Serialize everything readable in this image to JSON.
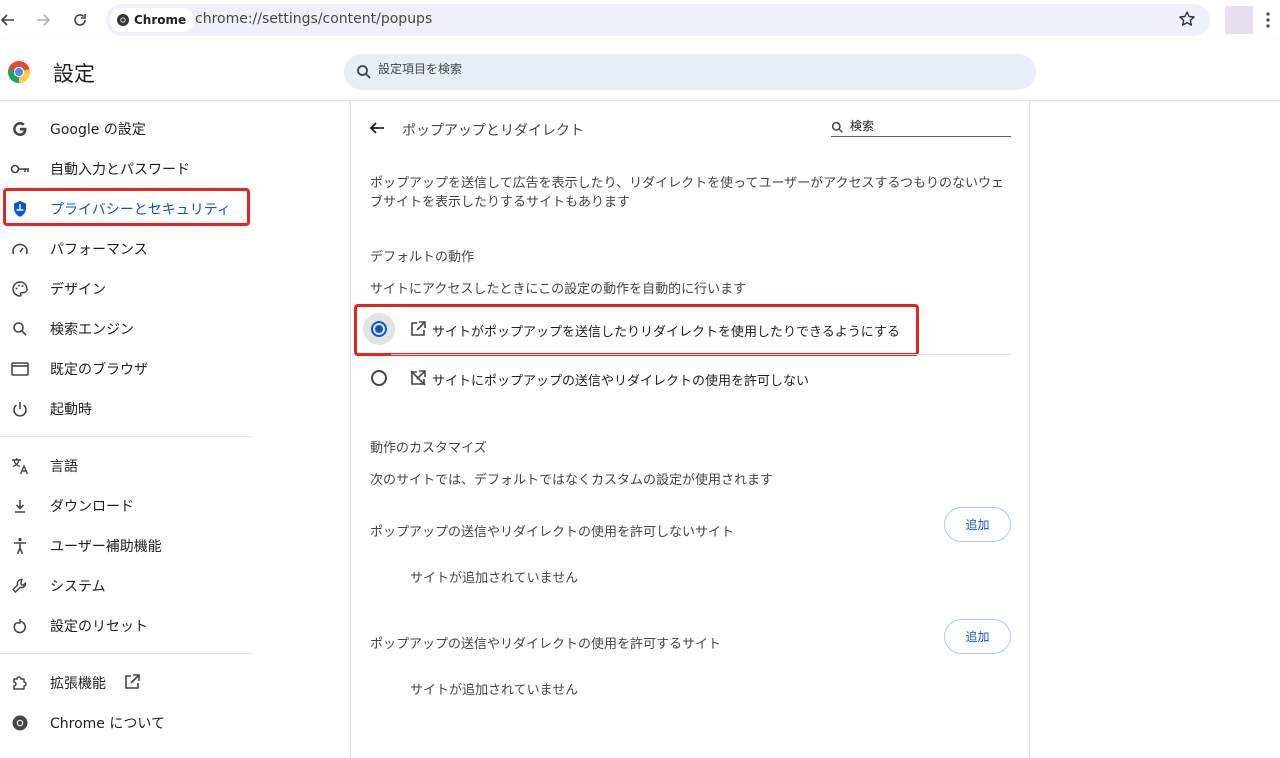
{
  "browser": {
    "chip_label": "Chrome",
    "url": "chrome://settings/content/popups"
  },
  "header": {
    "title": "設定",
    "search_placeholder": "設定項目を検索"
  },
  "sidebar": {
    "items": [
      {
        "label": "Google の設定",
        "icon": "google-g-icon"
      },
      {
        "label": "自動入力とパスワード",
        "icon": "key-icon"
      },
      {
        "label": "プライバシーとセキュリティ",
        "icon": "shield-icon"
      },
      {
        "label": "パフォーマンス",
        "icon": "speedometer-icon"
      },
      {
        "label": "デザイン",
        "icon": "palette-icon"
      },
      {
        "label": "検索エンジン",
        "icon": "search-icon"
      },
      {
        "label": "既定のブラウザ",
        "icon": "browser-window-icon"
      },
      {
        "label": "起動時",
        "icon": "power-icon"
      },
      {
        "label": "言語",
        "icon": "translate-icon"
      },
      {
        "label": "ダウンロード",
        "icon": "download-icon"
      },
      {
        "label": "ユーザー補助機能",
        "icon": "accessibility-icon"
      },
      {
        "label": "システム",
        "icon": "wrench-icon"
      },
      {
        "label": "設定のリセット",
        "icon": "reset-icon"
      },
      {
        "label": "拡張機能",
        "icon": "puzzle-icon"
      },
      {
        "label": "Chrome について",
        "icon": "chrome-icon"
      }
    ]
  },
  "content": {
    "title": "ポップアップとリダイレクト",
    "search_placeholder": "検索",
    "description": "ポップアップを送信して広告を表示したり、リダイレクトを使ってユーザーがアクセスするつもりのないウェブサイトを表示したりするサイトもあります",
    "default_heading": "デフォルトの動作",
    "default_sub": "サイトにアクセスしたときにこの設定の動作を自動的に行います",
    "options": [
      {
        "label": "サイトがポップアップを送信したりリダイレクトを使用したりできるようにする",
        "selected": true
      },
      {
        "label": "サイトにポップアップの送信やリダイレクトの使用を許可しない",
        "selected": false
      }
    ],
    "custom_heading": "動作のカスタマイズ",
    "custom_sub": "次のサイトでは、デフォルトではなくカスタムの設定が使用されます",
    "block_list_label": "ポップアップの送信やリダイレクトの使用を許可しないサイト",
    "allow_list_label": "ポップアップの送信やリダイレクトの使用を許可するサイト",
    "add_label": "追加",
    "empty_label": "サイトが追加されていません"
  },
  "colors": {
    "accent": "#0b57d0",
    "highlight": "#e8231f"
  }
}
